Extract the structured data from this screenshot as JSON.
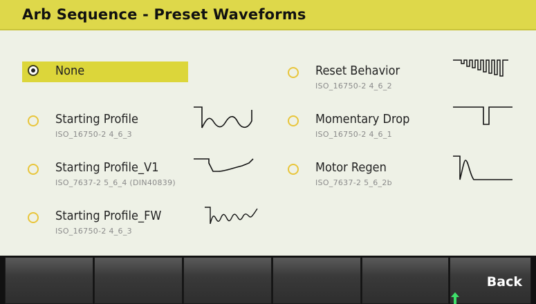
{
  "window": {
    "title": "Arb Sequence - Preset Waveforms"
  },
  "options": [
    {
      "label": "None",
      "subtitle": "",
      "selected": true,
      "icon": "none"
    },
    {
      "label": "Starting Profile",
      "subtitle": "ISO_16750-2 4_6_3",
      "selected": false,
      "icon": "starting-profile-waveform-icon"
    },
    {
      "label": "Starting Profile_V1",
      "subtitle": "ISO_7637-2 5_6_4 (DIN40839)",
      "selected": false,
      "icon": "starting-profile-v1-waveform-icon"
    },
    {
      "label": "Starting Profile_FW",
      "subtitle": "ISO_16750-2 4_6_3",
      "selected": false,
      "icon": "starting-profile-fw-waveform-icon"
    },
    {
      "label": "Reset Behavior",
      "subtitle": "ISO_16750-2 4_6_2",
      "selected": false,
      "icon": "reset-behavior-waveform-icon"
    },
    {
      "label": "Momentary Drop",
      "subtitle": "ISO_16750-2 4_6_1",
      "selected": false,
      "icon": "momentary-drop-waveform-icon"
    },
    {
      "label": "Motor Regen",
      "subtitle": "ISO_7637-2 5_6_2b",
      "selected": false,
      "icon": "motor-regen-waveform-icon"
    }
  ],
  "softkeys": [
    "",
    "",
    "",
    "",
    "",
    "Back"
  ],
  "colors": {
    "title_bg": "#ded84a",
    "selection": "#dcd63a",
    "background": "#eef1e6",
    "radio": "#e8c53a"
  },
  "cursor": {
    "icon": "green-arrow-cursor-icon"
  }
}
